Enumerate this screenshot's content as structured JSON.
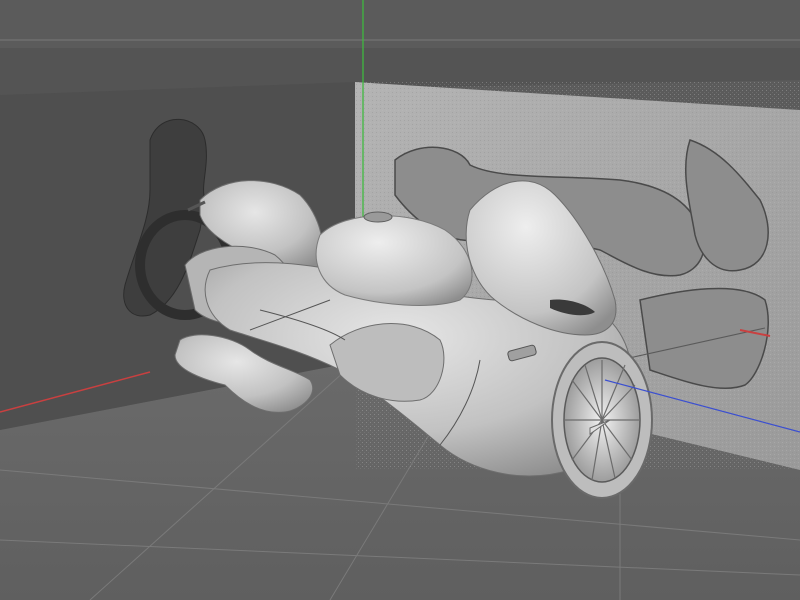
{
  "viewport": {
    "background": "#5b5b5b",
    "floor_color": "#656565",
    "back_wall_color": "#5a5a5a",
    "blueprint_wall_color": "#a6a6a6",
    "model_color": "#c3c3c3",
    "axis_colors": {
      "y": "#3fb83f",
      "x": "#d23a3a",
      "z": "#3b4fd0"
    }
  },
  "scene_objects": [
    "reference-plane-back",
    "reference-plane-side",
    "hover-bike-model",
    "jet-turbine",
    "world-axis-gizmo"
  ]
}
